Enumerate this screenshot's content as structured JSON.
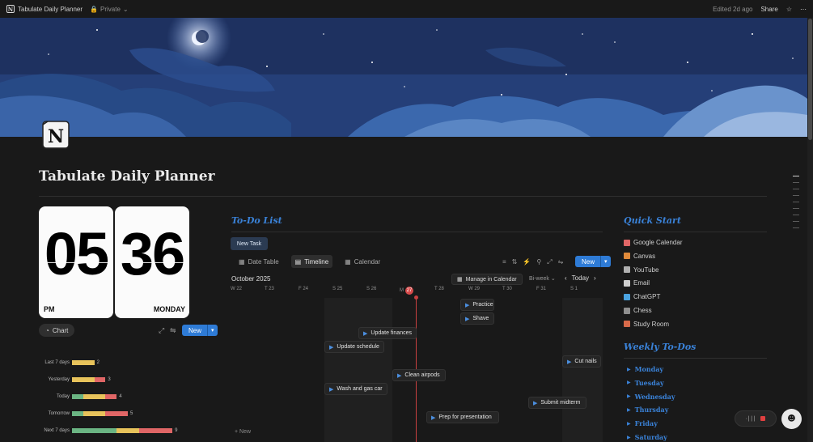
{
  "topbar": {
    "title": "Tabulate Daily Planner",
    "privacy": "Private",
    "edited": "Edited 2d ago",
    "share": "Share"
  },
  "page": {
    "title": "Tabulate Daily Planner",
    "icon_letter": "N"
  },
  "clock": {
    "hours": "05",
    "minutes": "36",
    "period": "PM",
    "weekday": "MONDAY"
  },
  "chart_controls": {
    "chart_label": "Chart",
    "new_label": "New"
  },
  "chart_data": {
    "type": "bar",
    "orientation": "horizontal",
    "stacked": true,
    "categories": [
      "Last 7 days",
      "Yesterday",
      "Today",
      "Tomorrow",
      "Next 7 days"
    ],
    "values": [
      2,
      3,
      4,
      5,
      9
    ],
    "segments": [
      [
        {
          "color": "#e8c35b",
          "value": 2
        }
      ],
      [
        {
          "color": "#e8c35b",
          "value": 2
        },
        {
          "color": "#e06666",
          "value": 1
        }
      ],
      [
        {
          "color": "#6bb583",
          "value": 1
        },
        {
          "color": "#e8c35b",
          "value": 2
        },
        {
          "color": "#e06666",
          "value": 1
        }
      ],
      [
        {
          "color": "#6bb583",
          "value": 1
        },
        {
          "color": "#e8c35b",
          "value": 2
        },
        {
          "color": "#e06666",
          "value": 2
        }
      ],
      [
        {
          "color": "#6bb583",
          "value": 4
        },
        {
          "color": "#e8c35b",
          "value": 2
        },
        {
          "color": "#e06666",
          "value": 3
        }
      ]
    ]
  },
  "todo": {
    "heading": "To-Do List",
    "new_task": "New Task",
    "tabs": [
      "Date Table",
      "Timeline",
      "Calendar"
    ],
    "active_tab": "Timeline",
    "new_label": "New",
    "month": "October 2025",
    "manage_label": "Manage in Calendar",
    "range_label": "Bi-week",
    "today_label": "Today",
    "days": [
      "W 22",
      "T 23",
      "F 24",
      "S 25",
      "S 26",
      "M",
      "T 28",
      "W 29",
      "T 30",
      "F 31",
      "S 1"
    ],
    "today_num": "27",
    "tasks": [
      {
        "label": "Practice"
      },
      {
        "label": "Shave"
      },
      {
        "label": "Update finances"
      },
      {
        "label": "Update schedule"
      },
      {
        "label": "Cut nails"
      },
      {
        "label": "Clean airpods"
      },
      {
        "label": "Wash and gas car"
      },
      {
        "label": "Submit midterm"
      },
      {
        "label": "Prep for presentation"
      }
    ],
    "add_new": "+ New"
  },
  "quick_start": {
    "heading": "Quick Start",
    "items": [
      {
        "label": "Google Calendar",
        "color": "#e06666"
      },
      {
        "label": "Canvas",
        "color": "#e08a3a"
      },
      {
        "label": "YouTube",
        "color": "#b0b0b0"
      },
      {
        "label": "Email",
        "color": "#cfcfcf"
      },
      {
        "label": "ChatGPT",
        "color": "#4aa3e0"
      },
      {
        "label": "Chess",
        "color": "#8f8f8f"
      },
      {
        "label": "Study Room",
        "color": "#d86a4a"
      }
    ]
  },
  "weekly": {
    "heading": "Weekly To-Dos",
    "days": [
      "Monday",
      "Tuesday",
      "Wednesday",
      "Thursday",
      "Friday",
      "Saturday"
    ]
  }
}
